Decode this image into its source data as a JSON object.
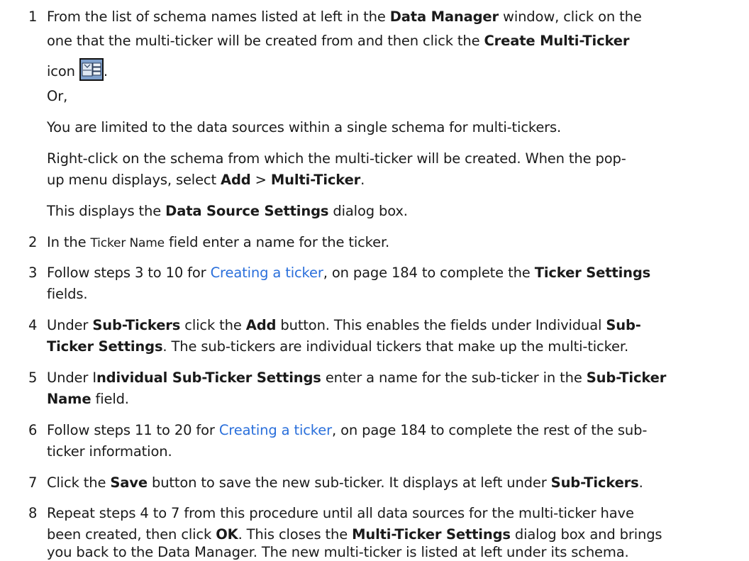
{
  "steps": {
    "s1": {
      "num": "1",
      "l1": "From the list of schema names listed at left in the ",
      "l1_b": "Data Manager",
      "l1_c": " window, click on the",
      "l2": "one that the multi-ticker will be created from and then click the ",
      "l2_b": "Create Multi-Ticker",
      "l3": "icon",
      "l3_end": "."
    },
    "or": "Or,",
    "limit": "You are limited to the data sources within a single schema for multi-tickers.",
    "right1": "Right-click on the schema from which the multi-ticker will be created. When the pop-",
    "right2_a": "up menu displays, select ",
    "right2_b1": "Add",
    "right2_sep": " > ",
    "right2_b2": "Multi-Ticker",
    "right2_end": ".",
    "displays_a": "This displays the ",
    "displays_b": "Data Source Settings",
    "displays_c": " dialog box.",
    "s2": {
      "num": "2",
      "a": "In the ",
      "field": "Ticker Name",
      "b": " field enter a name for the ticker."
    },
    "s3": {
      "num": "3",
      "a": "Follow steps 3 to 10 for ",
      "link": "Creating a ticker",
      "b": ", on page 184 to complete the ",
      "bold": "Ticker Settings",
      "l2": "fields."
    },
    "s4": {
      "num": "4",
      "a": "Under ",
      "b1": "Sub-Tickers",
      "c": " click the ",
      "b2": "Add",
      "d": " button. This enables the fields under Individual ",
      "b3": "Sub-",
      "l2_b": "Ticker Settings",
      "l2": ". The sub-tickers are individual tickers that make up the multi-ticker."
    },
    "s5": {
      "num": "5",
      "a": "Under I",
      "b1": "ndividual Sub-Ticker Settings",
      "c": " enter a name for the sub-ticker in the ",
      "b2": "Sub-Ticker",
      "l2_b": "Name",
      "l2": " field."
    },
    "s6": {
      "num": "6",
      "a": "Follow steps 11 to 20 for ",
      "link": "Creating a ticker",
      "b": ", on page 184 to complete the rest of the sub-",
      "l2": "ticker information."
    },
    "s7": {
      "num": "7",
      "a": "Click the ",
      "b1": "Save",
      "c": " button to save the new sub-ticker. It displays at left under ",
      "b2": "Sub-Tickers",
      "d": "."
    },
    "s8": {
      "num": "8",
      "l1": "Repeat steps 4 to 7 from this procedure until all data sources for the multi-ticker have",
      "l2_a": "been created, then click ",
      "l2_b": "OK",
      "l2_c": ". This closes the ",
      "l2_d": "Multi-Ticker Settings",
      "l2_e": " dialog box and brings",
      "l3": "you back to the Data Manager. The new multi-ticker is listed at left under its schema."
    }
  },
  "icon": "create-multi-ticker-icon",
  "link_color": "#2a6fdb"
}
